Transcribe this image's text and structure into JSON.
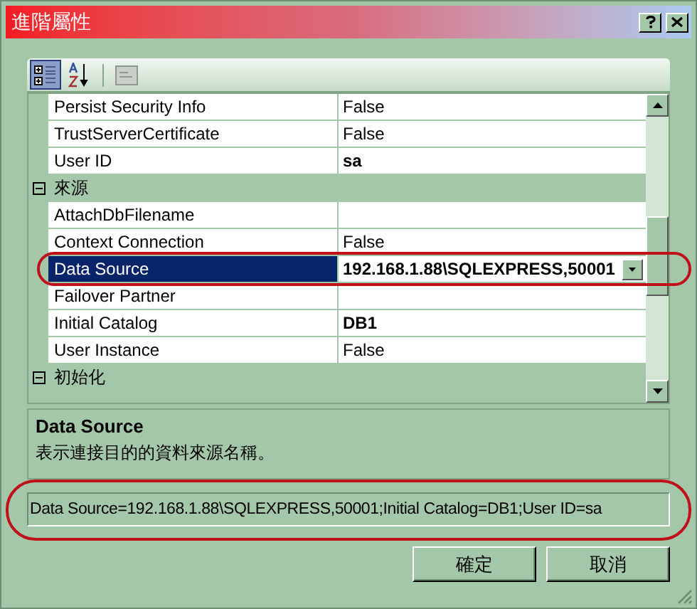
{
  "window": {
    "title": "進階屬性"
  },
  "toolbar": [
    {
      "kind": "categorized",
      "selected": true
    },
    {
      "kind": "alphabetical",
      "selected": false
    },
    {
      "kind": "pages",
      "selected": false
    }
  ],
  "properties": [
    {
      "kind": "property",
      "name": "Persist Security Info",
      "value": "False",
      "selected": false
    },
    {
      "kind": "property",
      "name": "TrustServerCertificate",
      "value": "False",
      "selected": false
    },
    {
      "kind": "property",
      "name": "User ID",
      "value": "sa",
      "selected": false,
      "bold": true
    },
    {
      "kind": "category",
      "name": "來源",
      "expanded": true
    },
    {
      "kind": "property",
      "name": "AttachDbFilename",
      "selected": false
    },
    {
      "kind": "property",
      "name": "Context Connection",
      "value": "False",
      "selected": false
    },
    {
      "kind": "property",
      "name": "Data Source",
      "value": "192.168.1.88\\SQLEXPRESS,50001",
      "selected": true,
      "dropdown": true,
      "bold": true
    },
    {
      "kind": "property",
      "name": "Failover Partner",
      "selected": false
    },
    {
      "kind": "property",
      "name": "Initial Catalog",
      "value": "DB1",
      "selected": false,
      "bold": true
    },
    {
      "kind": "property",
      "name": "User Instance",
      "value": "False",
      "selected": false
    },
    {
      "kind": "category",
      "name": "初始化",
      "expanded": true
    }
  ],
  "description": {
    "title": "Data Source",
    "text": "表示連接目的的資料來源名稱。"
  },
  "connection_string": "Data Source=192.168.1.88\\SQLEXPRESS,50001;Initial Catalog=DB1;User ID=sa",
  "buttons": [
    "確定",
    "取消"
  ]
}
